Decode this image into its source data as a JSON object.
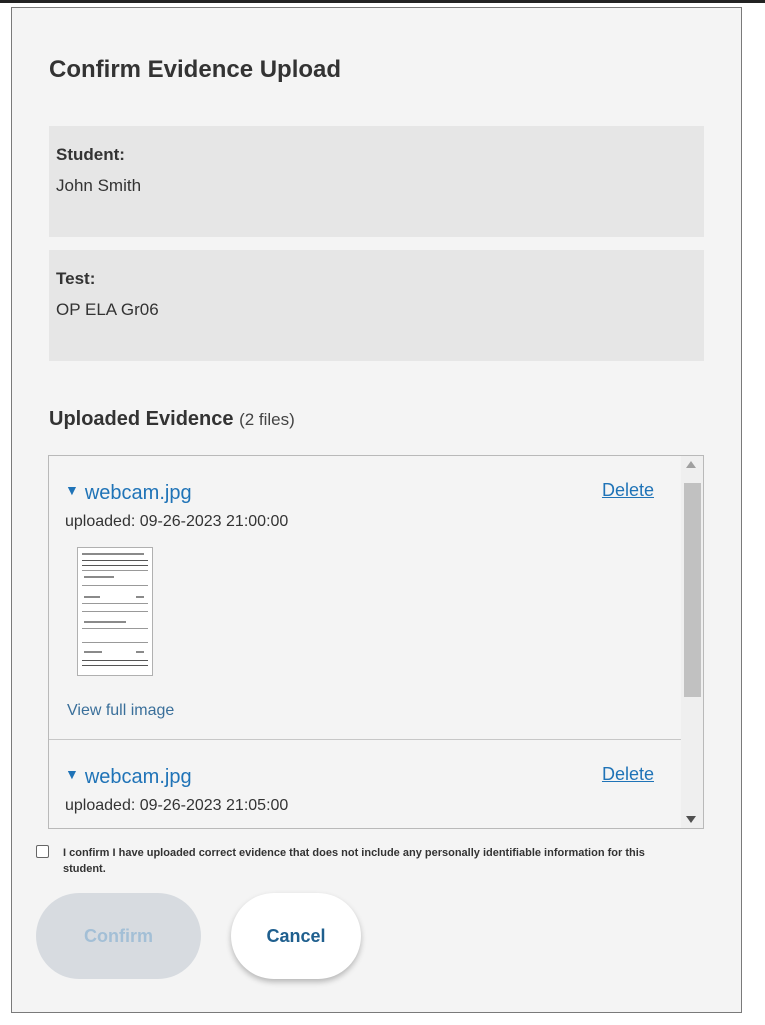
{
  "dialog": {
    "title": "Confirm Evidence Upload"
  },
  "student": {
    "label": "Student:",
    "value": "John Smith"
  },
  "test": {
    "label": "Test:",
    "value": "OP ELA Gr06"
  },
  "evidence": {
    "header": "Uploaded Evidence",
    "count": "(2 files)",
    "files": [
      {
        "name": "webcam.jpg",
        "uploaded": "uploaded: 09-26-2023 21:00:00",
        "delete_label": "Delete",
        "view_label": "View full image"
      },
      {
        "name": "webcam.jpg",
        "uploaded": "uploaded: 09-26-2023 21:05:00",
        "delete_label": "Delete"
      }
    ]
  },
  "confirm_checkbox": {
    "label": "I confirm I have uploaded correct evidence that does not include any personally identifiable information for this student.",
    "checked": false
  },
  "buttons": {
    "confirm": "Confirm",
    "cancel": "Cancel"
  },
  "colors": {
    "link": "#1f73b7",
    "panel_bg": "#f4f4f4",
    "info_bg": "#e6e6e6",
    "confirm_disabled_bg": "#d7dbe0"
  },
  "icons": {
    "expand": "triangle-down-icon"
  }
}
